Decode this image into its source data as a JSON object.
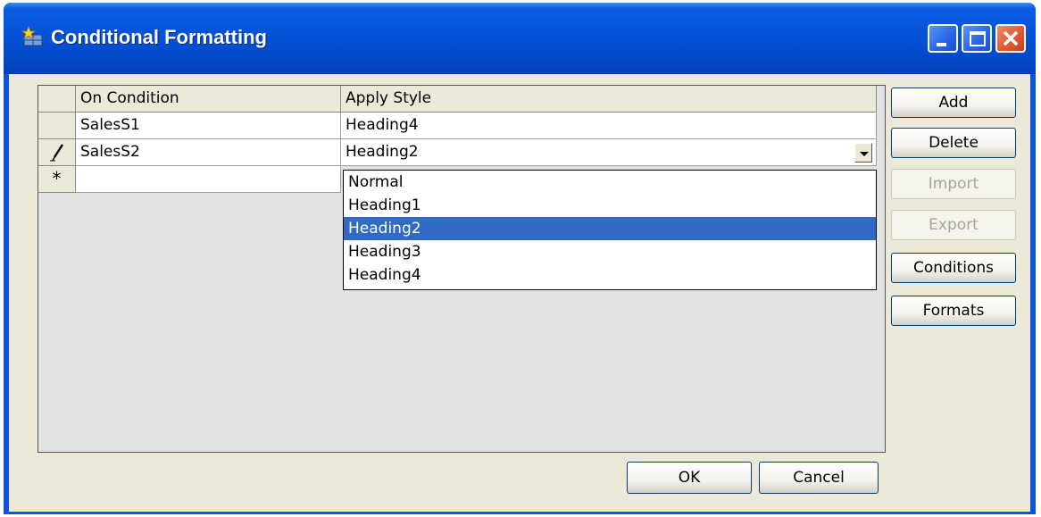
{
  "window": {
    "title": "Conditional Formatting"
  },
  "grid": {
    "columns": [
      "On Condition",
      "Apply Style"
    ],
    "rows": [
      {
        "indicator": "",
        "condition": "SalesS1",
        "style": "Heading4"
      },
      {
        "indicator": "pencil",
        "condition": "SalesS2",
        "style": "Heading2"
      },
      {
        "indicator": "*",
        "condition": "",
        "style": ""
      }
    ]
  },
  "dropdown": {
    "options": [
      "Normal",
      "Heading1",
      "Heading2",
      "Heading3",
      "Heading4"
    ],
    "selected": "Heading2"
  },
  "buttons": {
    "add": "Add",
    "delete": "Delete",
    "import": "Import",
    "export": "Export",
    "conditions": "Conditions",
    "formats": "Formats",
    "ok": "OK",
    "cancel": "Cancel"
  },
  "colors": {
    "titlebar": "#0453d9",
    "dialog_bg": "#ece9d8",
    "selection": "#316ac5",
    "close_button": "#e05a35"
  }
}
